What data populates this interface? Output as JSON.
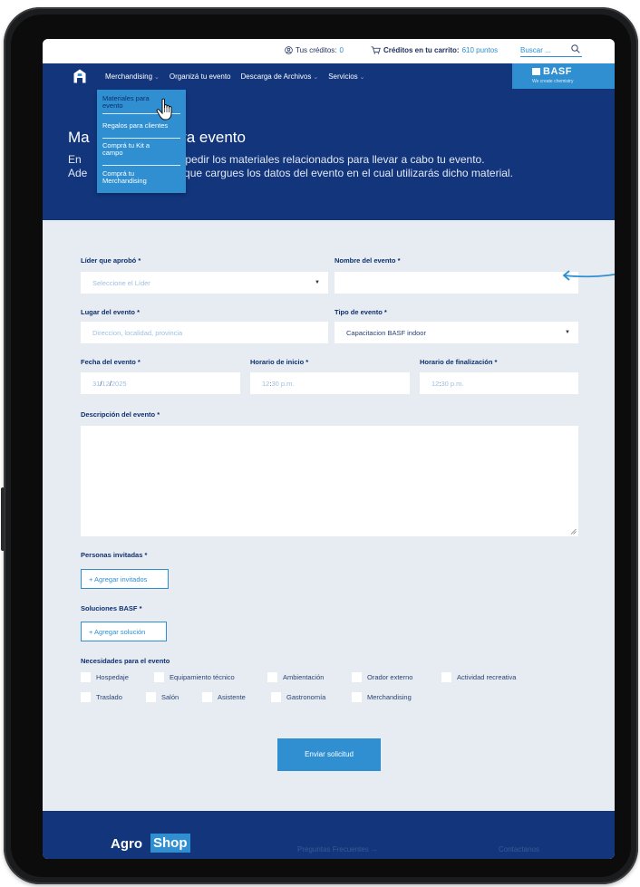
{
  "topbar": {
    "credits_label": "Tus créditos:",
    "credits_value": "0",
    "cart_label": "Créditos en tu carrito:",
    "cart_value": "610 puntos",
    "search_placeholder": "Buscar ...",
    "user_icon": "user-circle-icon",
    "cart_icon": "cart-icon",
    "search_icon": "search-icon"
  },
  "nav": {
    "home_icon": "home-icon",
    "items": [
      {
        "label": "Merchandising",
        "has_dropdown": true
      },
      {
        "label": "Organizá tu evento",
        "has_dropdown": false
      },
      {
        "label": "Descarga de Archivos",
        "has_dropdown": true
      },
      {
        "label": "Servicios",
        "has_dropdown": true
      }
    ],
    "dropdown_items": [
      "Materiales para evento",
      "Regalos para clientes",
      "Comprá tu Kit a campo",
      "Comprá tu Merchandising"
    ]
  },
  "brand": {
    "logo": "BASF",
    "tagline": "We create chemistry"
  },
  "hero": {
    "title_visible": "Ma",
    "title_visible_end": "ara evento",
    "desc_line1_start": "En",
    "desc_line1_end": "drás pedir los materiales relacionados para llevar a cabo tu evento.",
    "desc_line2_start": "Ade",
    "desc_line2_end": "nos que cargues los datos del evento en el cual utilizarás dicho material."
  },
  "form": {
    "leader_label": "Líder que aprobó *",
    "leader_placeholder": "Seleccione el Líder",
    "event_name_label": "Nombre del evento *",
    "event_name_value": "",
    "place_label": "Lugar del evento *",
    "place_placeholder": "Direccion, localidad, provincia",
    "type_label": "Tipo de evento *",
    "type_value": "Capacitacion BASF indoor",
    "date_label": "Fecha del evento *",
    "date_day": "31",
    "date_month": "12",
    "date_year": "2025",
    "start_label": "Horario de inicio *",
    "start_h": "12",
    "start_m": "30 p.m.",
    "end_label": "Horario de finalización *",
    "end_h": "12",
    "end_m": "30 p.m.",
    "description_label": "Descripción del evento *",
    "description_value": "",
    "guests_label": "Personas invitadas *",
    "guests_button": "+ Agregar invitados",
    "solutions_label": "Soluciones BASF *",
    "solutions_button": "+ Agregar solución",
    "needs_label": "Necesidades para el evento",
    "needs_row1": [
      "Hospedaje",
      "Equipamiento técnico",
      "Ambientación",
      "Orador externo",
      "Actividad recreativa"
    ],
    "needs_row2": [
      "Traslado",
      "Salón",
      "Asistente",
      "Gastronomía",
      "Merchandising"
    ],
    "submit": "Enviar solicitud"
  },
  "footer": {
    "brand_a": "Agro",
    "brand_b": "Shop",
    "faq": "Preguntas Frecuentes →",
    "contact": "Contactanos"
  },
  "colors": {
    "navy": "#12357c",
    "accent": "#2f8fd1",
    "background": "#e7ecf2"
  }
}
